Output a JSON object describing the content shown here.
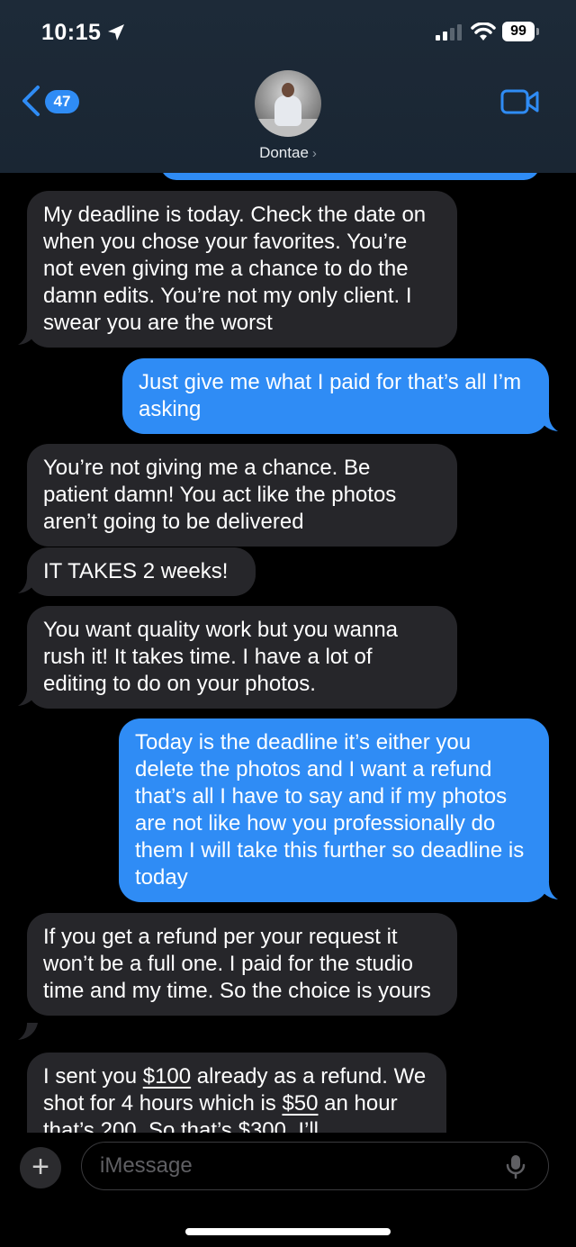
{
  "status_bar": {
    "time": "10:15",
    "battery": "99"
  },
  "header": {
    "back_count": "47",
    "contact_name": "Dontae",
    "contact_chevron": "›"
  },
  "colors": {
    "incoming": "#26262a",
    "outgoing": "#2f8cf5",
    "header": "#1d2a38"
  },
  "messages": [
    {
      "dir": "in",
      "text": "My deadline is today. Check the date on when you chose your favorites. You’re not even giving me a chance to do the damn edits. You’re not my only client. I swear you are the worst"
    },
    {
      "dir": "out",
      "text": "Just give me what I paid for that’s all I’m asking"
    },
    {
      "dir": "in",
      "text": "You’re not giving me a chance. Be patient damn! You act like the photos aren’t going to be delivered"
    },
    {
      "dir": "in",
      "text": "IT TAKES 2 weeks!"
    },
    {
      "dir": "in",
      "text": "You want quality work but you wanna rush it! It takes time. I have a lot of editing to do on your photos."
    },
    {
      "dir": "out",
      "text": "Today is the deadline it’s either you delete the photos and I want a refund that’s all I have to say and if my photos are not like how you professionally do them I will take this further so deadline is today"
    },
    {
      "dir": "in",
      "text": "If you get a refund per your request it won’t be a full one. I paid for the studio time and my time. So the choice is yours"
    },
    {
      "dir": "in",
      "parts": [
        "I sent you ",
        "$100",
        " already as a refund. We shot for 4 hours which is ",
        "$50",
        " an hour that’s 200. So that’s ",
        "$300",
        ". I’ll"
      ]
    }
  ],
  "composer": {
    "placeholder": "iMessage"
  }
}
